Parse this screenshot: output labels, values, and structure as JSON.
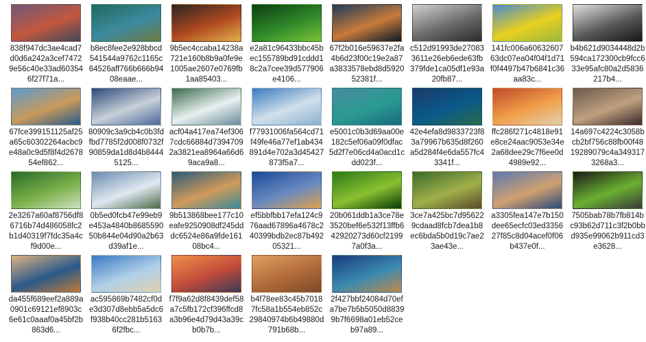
{
  "items": [
    {
      "name": "838f947dc3ae4cad7d0d6a242a3cef74729e56c40e33ad603546f27f71a...",
      "colors": [
        "#6d5a7a",
        "#c4573e",
        "#3f4a5a"
      ]
    },
    {
      "name": "b8ec8fee2e928bbcd541544a9762c1165c64526aff766b666b9408eaae...",
      "colors": [
        "#1f6a5c",
        "#3d8aa0",
        "#6d7a3f"
      ]
    },
    {
      "name": "9b5ec4ccaba14238a721e160b8b9a0fe9e1005ae2607e0769fb1aa85403...",
      "colors": [
        "#2a2522",
        "#b04a1f",
        "#e0b04a"
      ]
    },
    {
      "name": "e2a81c96433bbc45bec155789bd91cddd18c2a7cee39d577906e4106...",
      "colors": [
        "#0e3d12",
        "#2f8a2a",
        "#7bc23a"
      ]
    },
    {
      "name": "67f2b016e59637e2fa4b6d23f00c19e2a87a3833578ebd8d592052381f...",
      "colors": [
        "#1b3a5c",
        "#c87b3a",
        "#0a1a2a"
      ]
    },
    {
      "name": "c512d91993de270833611e26eb6ede63fb379fde1ca05df1e93a20fb87...",
      "colors": [
        "#d0d0d0",
        "#6a6a6a",
        "#2a2a2a"
      ]
    },
    {
      "name": "141fc006a6063260763dc07ea04f04f1d71f0f4497b47b6841c36aa83c...",
      "colors": [
        "#4a8ad0",
        "#e8d020",
        "#9ab83a"
      ]
    },
    {
      "name": "b4b621d9034448d2b594ca172300cb9fcc633e95afc80a2d5836217b4...",
      "colors": [
        "#e0e0e0",
        "#5a5a5a",
        "#151515"
      ]
    },
    {
      "name": "67fce399151125af25a65c60302264acbc9e48a0c9d5f8f4d267854ef862...",
      "colors": [
        "#5a9ad0",
        "#c99a5a",
        "#2a5a8a"
      ]
    },
    {
      "name": "80909c3a9cb4c0b3fdfbd7785f2d008f0732f90859da1d8d4b84445125...",
      "colors": [
        "#2a4a7a",
        "#c8d0d8",
        "#4a6a9a"
      ]
    },
    {
      "name": "acf04a417ea74ef3067cdc66884d73947092a3821ea8964a66d69aca9a8...",
      "colors": [
        "#3a6a4a",
        "#e8f0f0",
        "#6a8a9a"
      ]
    },
    {
      "name": "f77931006fa564cd71f49fe46a77ef1ab434891d4e702a3d45427873f5a7...",
      "colors": [
        "#3a7ac0",
        "#d0e0ea",
        "#8ab0d0"
      ]
    },
    {
      "name": "e5001c0b3d69aa00e182c5ef06a09f0dfac5d2f7e06cd4a0acd1cdd023f...",
      "colors": [
        "#4a8aa0",
        "#2a9a90",
        "#1a6a80"
      ]
    },
    {
      "name": "42e4efa8d9833723f83a79967b635d8f260a5d284f4e6da557fc43341f...",
      "colors": [
        "#1a3a6a",
        "#0a5a8a",
        "#2a6a4a"
      ]
    },
    {
      "name": "ffc286f271c4818e91e8ce24aac9053e34e2a68dee29c7f6ee0d4989e92...",
      "colors": [
        "#c04a2a",
        "#f0a04a",
        "#e0d0b0"
      ]
    },
    {
      "name": "14a697c4224c3058bcb2bf756c88fb00f4819289079c4a3493173268a3...",
      "colors": [
        "#6a5a4a",
        "#c0a080",
        "#3a2a2a"
      ]
    },
    {
      "name": "2e3267a60af8756df86716b74d486058fc2b1d40319f7fdc35a4cf9d00e...",
      "colors": [
        "#2a6a2a",
        "#7ab04a",
        "#d0e0c0"
      ]
    },
    {
      "name": "0b5ed0fcb47e99eb9e453a4840b868559050b844e04d90a2b63d39af1e...",
      "colors": [
        "#6a8ab0",
        "#e0e8f0",
        "#4a6a4a"
      ]
    },
    {
      "name": "9b513868bee177c10eafe9250908df245dddc6524e86a9fde16108bc4...",
      "colors": [
        "#2a5a7a",
        "#d09a5a",
        "#3a8a9a"
      ]
    },
    {
      "name": "ef5bbfbb17efa124c976aad67896a4678c240399bdb2ec87b49205321...",
      "colors": [
        "#1a4a9a",
        "#6a8ac0",
        "#e0a04a"
      ]
    },
    {
      "name": "20b061ddb1a3ce78e3520bef6e532f13ffb642920273d60cf21997a0f3a...",
      "colors": [
        "#2a7a1a",
        "#8ac030",
        "#0a3a0a"
      ]
    },
    {
      "name": "3ce7a425bc7d956229cdaad8fcb7dea1b8ec6bda5b0d19c7ae23ae43e...",
      "colors": [
        "#3a6a2a",
        "#a0b04a",
        "#5a4a2a"
      ]
    },
    {
      "name": "a3305fea147e7b150dee65ecfc03ed335627f85c8d04acef0f06b437e0f...",
      "colors": [
        "#5a7ab0",
        "#d0a070",
        "#2a4a7a"
      ]
    },
    {
      "name": "7505bab78b7fb814bc93b62d711c3f2b0bbd935e99062b911cd3e3628...",
      "colors": [
        "#1a1a1a",
        "#6ab030",
        "#3a3a3a"
      ]
    },
    {
      "name": "da455f689eef2a889a0901c69121ef8903c6e61c0aaaf0a45bf2b863d6...",
      "colors": [
        "#e0b080",
        "#2a5a8a",
        "#c07a3a"
      ]
    },
    {
      "name": "ac595869b7482cf0de3d307d8ebb5a5dc6f938b40cc281b51636f2fbc...",
      "colors": [
        "#3a7ac0",
        "#b0d0e8",
        "#e0d0b0"
      ]
    },
    {
      "name": "f7f9a62d8f8439def58a7c5fb172cf396ffcd8a3b96e4d79d43a39cb0b7b...",
      "colors": [
        "#f0904a",
        "#c04a3a",
        "#3a3a5a"
      ]
    },
    {
      "name": "b4f78ee83c45b70187fc58a1b554eb852c29840974b6b49880d791b68b...",
      "colors": [
        "#e0a060",
        "#b06a3a",
        "#7a4a2a"
      ]
    },
    {
      "name": "2f427bbf24084d70efa7be7b5b5050d88399b7f6698a01eb52ceb97a89...",
      "colors": [
        "#1a3a7a",
        "#3a8ab0",
        "#c08a4a"
      ]
    }
  ]
}
